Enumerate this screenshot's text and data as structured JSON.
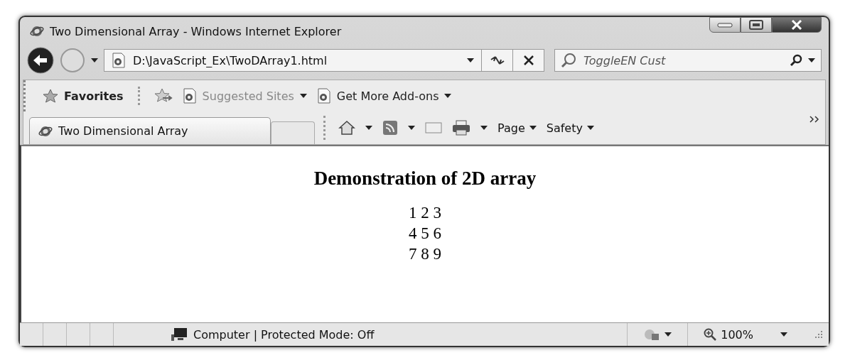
{
  "window": {
    "title": "Two Dimensional Array - Windows Internet Explorer"
  },
  "address_bar": {
    "value": "D:\\JavaScript_Ex\\TwoDArray1.html"
  },
  "search": {
    "placeholder": "ToggleEN Cust"
  },
  "favorites_bar": {
    "label": "Favorites",
    "links": [
      {
        "label": "Suggested Sites",
        "disabled": true
      },
      {
        "label": "Get More Add-ons",
        "disabled": false
      }
    ]
  },
  "tabs": [
    {
      "label": "Two Dimensional Array",
      "selected": true
    }
  ],
  "command_bar": {
    "items": [
      {
        "label": "Page"
      },
      {
        "label": "Safety"
      }
    ]
  },
  "page": {
    "heading": "Demonstration of 2D array",
    "rows": [
      "1 2 3",
      "4 5 6",
      "7 8 9"
    ]
  },
  "status_bar": {
    "zone": "Computer | Protected Mode: Off",
    "zoom": "100%"
  }
}
